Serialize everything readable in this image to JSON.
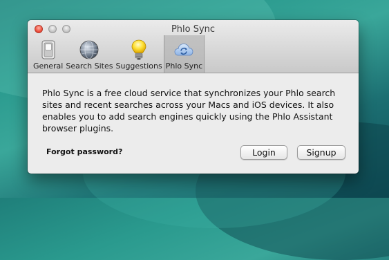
{
  "window": {
    "title": "Phlo Sync"
  },
  "toolbar": {
    "items": [
      {
        "label": "General",
        "icon": "switch-icon"
      },
      {
        "label": "Search Sites",
        "icon": "globe-icon"
      },
      {
        "label": "Suggestions",
        "icon": "lightbulb-icon"
      },
      {
        "label": "Phlo Sync",
        "icon": "cloud-sync-icon",
        "selected": true
      }
    ]
  },
  "main": {
    "description": "Phlo Sync is a free cloud service that synchronizes your Phlo search sites and recent searches across your Macs and iOS devices. It also enables you to add search engines quickly using the Phlo Assistant browser plugins.",
    "forgot_password": "Forgot password?",
    "login_label": "Login",
    "signup_label": "Signup"
  }
}
